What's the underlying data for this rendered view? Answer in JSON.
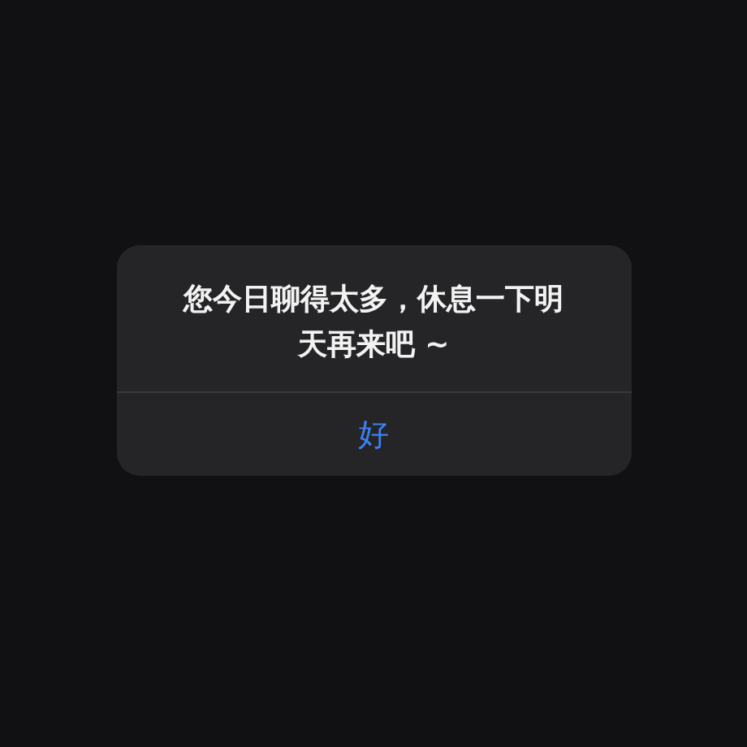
{
  "alert": {
    "message": "您今日聊得太多，休息一下明天再来吧 ~",
    "buttons": [
      "好"
    ]
  }
}
